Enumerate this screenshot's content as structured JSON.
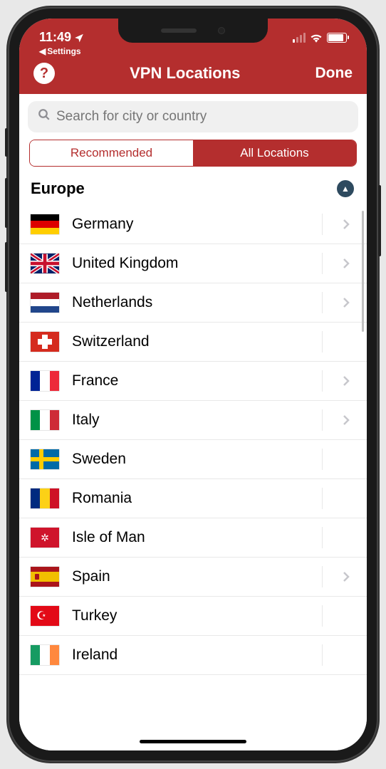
{
  "status": {
    "time": "11:49",
    "back_app": "Settings"
  },
  "header": {
    "title": "VPN Locations",
    "done": "Done",
    "help_symbol": "?"
  },
  "search": {
    "placeholder": "Search for city or country"
  },
  "tabs": {
    "recommended": "Recommended",
    "all": "All Locations",
    "active": "all"
  },
  "section": {
    "title": "Europe"
  },
  "countries": [
    {
      "name": "Germany",
      "flag": "de",
      "expandable": true
    },
    {
      "name": "United Kingdom",
      "flag": "uk",
      "expandable": true
    },
    {
      "name": "Netherlands",
      "flag": "nl",
      "expandable": true
    },
    {
      "name": "Switzerland",
      "flag": "ch",
      "expandable": false
    },
    {
      "name": "France",
      "flag": "fr",
      "expandable": true
    },
    {
      "name": "Italy",
      "flag": "it",
      "expandable": true
    },
    {
      "name": "Sweden",
      "flag": "se",
      "expandable": false
    },
    {
      "name": "Romania",
      "flag": "ro",
      "expandable": false
    },
    {
      "name": "Isle of Man",
      "flag": "im",
      "expandable": false
    },
    {
      "name": "Spain",
      "flag": "es",
      "expandable": true
    },
    {
      "name": "Turkey",
      "flag": "tr",
      "expandable": false
    },
    {
      "name": "Ireland",
      "flag": "ie",
      "expandable": false
    }
  ]
}
